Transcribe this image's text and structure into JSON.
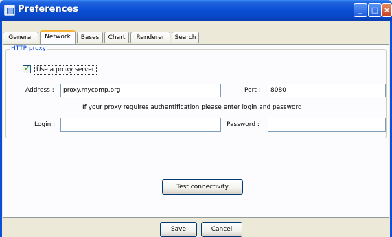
{
  "window": {
    "title": "Preferences",
    "minimize": "_",
    "maximize": "□",
    "close": "×"
  },
  "tabs": [
    "General",
    "Network",
    "Bases",
    "Chart",
    "Renderer",
    "Search"
  ],
  "active_tab": "Network",
  "proxy": {
    "group_title": "HTTP proxy",
    "use_proxy_label": "Use a proxy server",
    "use_proxy_checked": true,
    "address_label": "Address :",
    "address_value": "proxy.mycomp.org",
    "port_label": "Port :",
    "port_value": "8080",
    "auth_note": "If your proxy requires authentification please enter login and password",
    "login_label": "Login :",
    "login_value": "",
    "password_label": "Password :",
    "password_value": ""
  },
  "test_button": "Test connectivity",
  "footer": {
    "save": "Save",
    "cancel": "Cancel"
  }
}
